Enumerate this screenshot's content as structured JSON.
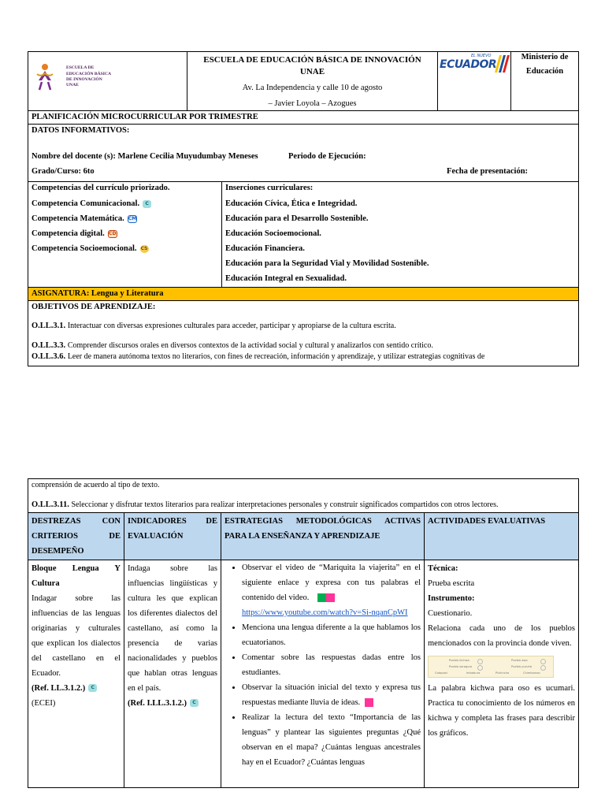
{
  "header": {
    "school_logo_lines": [
      "ESCUELA DE",
      "EDUCACIÓN BÁSICA",
      "DE INNOVACIÓN",
      "UNAE"
    ],
    "school_name": "ESCUELA DE EDUCACIÓN BÁSICA DE INNOVACIÓN UNAE",
    "address": "Av. La Independencia y calle 10 de agosto",
    "location": "– Javier Loyola – Azogues",
    "ecuador_logo_top": "EL NUEVO",
    "ecuador_logo_text": "ECUADOR",
    "ministry_line1": "Ministerio de",
    "ministry_line2": "Educación"
  },
  "plan_title": "PLANIFICACIÓN MICROCURRICULAR POR TRIMESTRE",
  "datos": {
    "title": "DATOS INFORMATIVOS:",
    "docente_label": "Nombre del docente (s): Marlene Cecilia Muyudumbay Meneses",
    "periodo_label": "Periodo de Ejecución:",
    "grado_label": "Grado/Curso: 6to",
    "fecha_label": "Fecha de presentación:"
  },
  "competencias": {
    "title": "Competencias del currículo priorizado.",
    "items": [
      {
        "text": "Competencia Comunicacional.",
        "badge": "C"
      },
      {
        "text": "Competencia Matemática.",
        "badge": "CM"
      },
      {
        "text": "Competencia digital.",
        "badge": "CD"
      },
      {
        "text": "Competencia Socioemocional.",
        "badge": "CS"
      }
    ]
  },
  "inserciones": {
    "title": "Inserciones curriculares:",
    "items": [
      "Educación Cívica, Ética e Integridad.",
      "Educación para el Desarrollo Sostenible.",
      "Educación Socioemocional.",
      "Educación Financiera.",
      "Educación para la Seguridad Vial y Movilidad Sostenible.",
      "Educación Integral en Sexualidad."
    ]
  },
  "asignatura": "ASIGNATURA: Lengua y Literatura",
  "objetivos": {
    "title": "OBJETIVOS DE APRENDIZAJE:",
    "o1_code": "O.LL.3.1.",
    "o1_text": "Interactuar con diversas expresiones culturales para acceder, participar y apropiarse de la cultura escrita.",
    "o2_code": "O.LL.3.3.",
    "o2_text": "Comprender discursos orales en diversos contextos de la actividad social y cultural y analizarlos con sentido crítico.",
    "o3_code": "O.LL.3.6.",
    "o3_text": "Leer de manera autónoma textos no literarios, con fines de recreación, información y aprendizaje, y utilizar estrategias cognitivas de",
    "o3_cont": "comprensión de acuerdo al tipo de texto.",
    "o4_code": "O.LL.3.11.",
    "o4_text": "Seleccionar y disfrutar textos literarios para realizar interpretaciones personales y construir significados compartidos con otros lectores."
  },
  "columns": {
    "c1": "DESTREZAS CON CRITERIOS DE DESEMPEÑO",
    "c2": "INDICADORES DE EVALUACIÓN",
    "c3": "ESTRATEGIAS METODOLÓGICAS ACTIVAS PARA LA ENSEÑANZA Y APRENDIZAJE",
    "c4": "ACTIVIDADES EVALUATIVAS"
  },
  "destrezas": {
    "block_title": "Bloque Lengua Y Cultura",
    "text": "Indagar sobre las influencias de las lenguas originarias y culturales que explican los dialectos del castellano en el Ecuador.",
    "ref": "(Ref. LL.3.1.2.)",
    "ecei": "(ECEI)"
  },
  "indicadores": {
    "text": "Indaga sobre las influencias lingüísticas y cultura les que explican los diferentes dialectos del castellano, así como la presencia de varias nacionalidades y pueblos que hablan otras lenguas en el país.",
    "ref": "(Ref. I.LL.3.1.2.)"
  },
  "estrategias": {
    "items": [
      "Observar el video de “Mariquita la viajerita” en el siguiente enlace y expresa con tus palabras el contenido del video.",
      "Menciona una lengua diferente a la que hablamos los ecuatorianos.",
      "Comentar sobre las respuestas dadas entre los estudiantes.",
      "Observar la situación inicial del texto y expresa tus respuestas mediante lluvia de ideas.",
      "Realizar la lectura del texto “Importancia de las lenguas” y plantear las siguientes preguntas ¿Qué observan en el mapa? ¿Cuántas lenguas ancestrales hay en el Ecuador? ¿Cuántas lenguas"
    ],
    "link": "https://www.youtube.com/watch?v=Si-nqanCpWI"
  },
  "actividades": {
    "tecnica_label": "Técnica:",
    "tecnica": "Prueba escrita",
    "instrumento_label": "Instrumento:",
    "instrumento": "Cuestionario.",
    "relaciona": "Relaciona cada uno de los pueblos mencionados con la provincia donde viven.",
    "mini_cells": [
      "Pueblo kichwa",
      "Pueblo awa",
      "Pueblo saraguro",
      "Pueblo puruhá",
      "Cotopaxi",
      "Imbabura",
      "Pichincha",
      "Chimborazo"
    ],
    "kichwa": "La palabra kichwa para oso es ucumari. Practica tu conocimiento de los números en kichwa y completa las frases para describir los gráficos."
  },
  "colors": {
    "asignatura_bg": "#ffc000",
    "header_blue": "#bdd7ee",
    "green_swatch": "#00b050",
    "pink_swatch": "#ff3399"
  }
}
